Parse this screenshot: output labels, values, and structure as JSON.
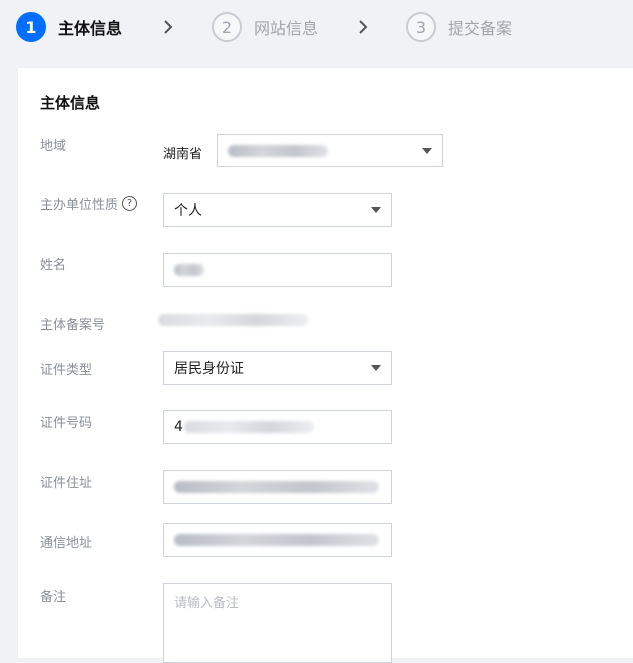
{
  "steps": [
    {
      "number": "1",
      "label": "主体信息",
      "state": "active"
    },
    {
      "number": "2",
      "label": "网站信息",
      "state": "inactive"
    },
    {
      "number": "3",
      "label": "提交备案",
      "state": "inactive"
    }
  ],
  "panel": {
    "title": "主体信息"
  },
  "form": {
    "region": {
      "label": "地域",
      "province": "湖南省"
    },
    "unit_type": {
      "label": "主办单位性质",
      "value": "个人"
    },
    "name": {
      "label": "姓名"
    },
    "record_no": {
      "label": "主体备案号"
    },
    "id_type": {
      "label": "证件类型",
      "value": "居民身份证"
    },
    "id_number": {
      "label": "证件号码",
      "visible_prefix": "4"
    },
    "id_address": {
      "label": "证件住址"
    },
    "contact_address": {
      "label": "通信地址"
    },
    "remark": {
      "label": "备注",
      "placeholder": "请输入备注"
    }
  },
  "colors": {
    "accent": "#006eff",
    "background": "#f0f2f5",
    "panel": "#ffffff"
  }
}
